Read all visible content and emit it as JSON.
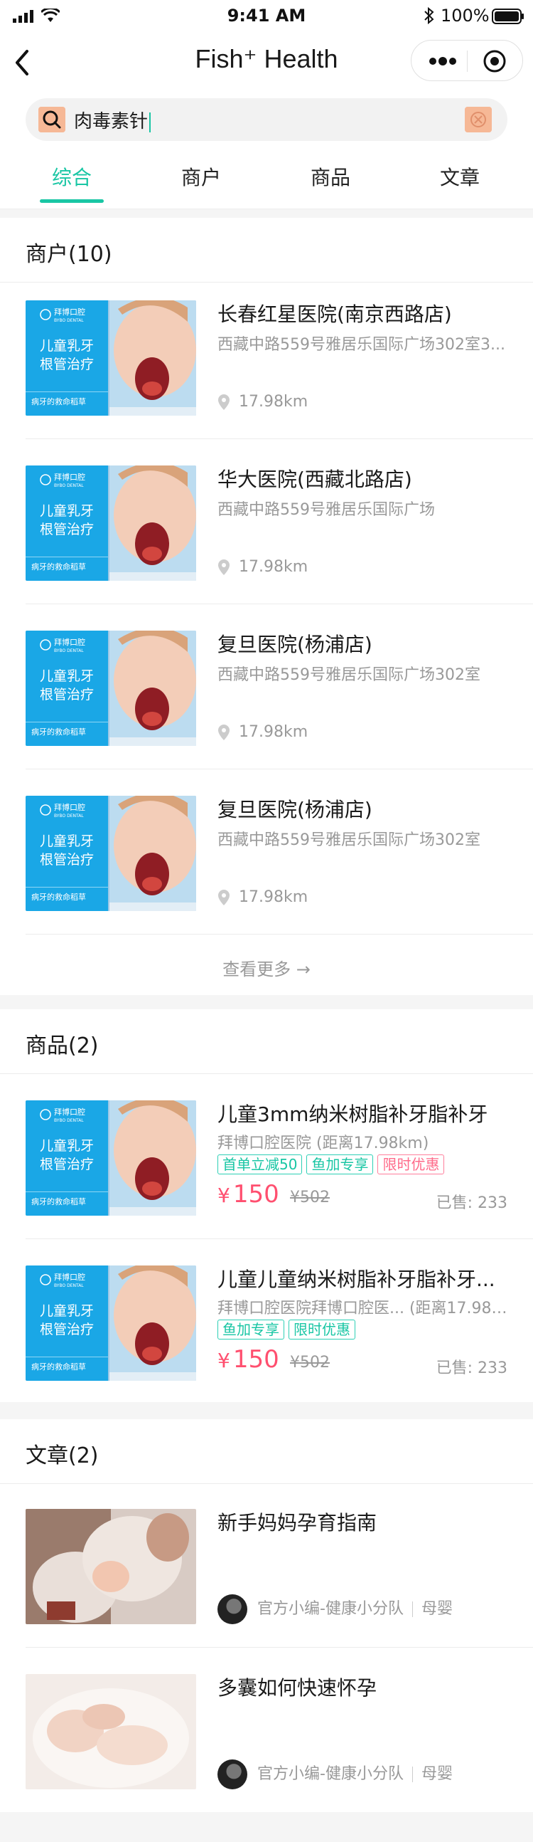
{
  "status_bar": {
    "time": "9:41 AM",
    "battery": "100%"
  },
  "nav": {
    "title": "Fish⁺ Health"
  },
  "search": {
    "query": "肉毒素针"
  },
  "tabs": [
    {
      "label": "综合"
    },
    {
      "label": "商户"
    },
    {
      "label": "商品"
    },
    {
      "label": "文章"
    }
  ],
  "merchants": {
    "title": "商户(10)",
    "more": "查看更多 →",
    "items": [
      {
        "name": "长春红星医院(南京西路店)",
        "address": "西藏中路559号雅居乐国际广场302室3...",
        "distance": "17.98km",
        "thumb_title": "儿童乳牙根管治疗",
        "thumb_brand": "拜博口腔",
        "thumb_foot": "病牙的救命稻草"
      },
      {
        "name": "华大医院(西藏北路店)",
        "address": "西藏中路559号雅居乐国际广场",
        "distance": "17.98km",
        "thumb_title": "儿童乳牙根管治疗",
        "thumb_brand": "拜博口腔",
        "thumb_foot": "病牙的救命稻草"
      },
      {
        "name": "复旦医院(杨浦店)",
        "address": "西藏中路559号雅居乐国际广场302室",
        "distance": "17.98km",
        "thumb_title": "儿童乳牙根管治疗",
        "thumb_brand": "拜博口腔",
        "thumb_foot": "病牙的救命稻草"
      },
      {
        "name": "复旦医院(杨浦店)",
        "address": "西藏中路559号雅居乐国际广场302室",
        "distance": "17.98km",
        "thumb_title": "儿童乳牙根管治疗",
        "thumb_brand": "拜博口腔",
        "thumb_foot": "病牙的救命稻草"
      }
    ]
  },
  "products": {
    "title": "商品(2)",
    "items": [
      {
        "name": "儿童3mm纳米树脂补牙脂补牙",
        "shop": "拜博口腔医院 (距离17.98km)",
        "tags": [
          "首单立减50",
          "鱼加专享",
          "限时优惠"
        ],
        "price_symbol": "¥",
        "price": "150",
        "old_price": "¥502",
        "sold": "已售: 233",
        "thumb_title": "儿童乳牙根管治疗",
        "thumb_brand": "拜博口腔",
        "thumb_foot": "病牙的救命稻草"
      },
      {
        "name": "儿童儿童纳米树脂补牙脂补牙...",
        "shop": "拜博口腔医院拜博口腔医... (距离17.98km)",
        "tags": [
          "鱼加专享",
          "限时优惠"
        ],
        "price_symbol": "¥",
        "price": "150",
        "old_price": "¥502",
        "sold": "已售: 233",
        "thumb_title": "儿童乳牙根管治疗",
        "thumb_brand": "拜博口腔",
        "thumb_foot": "病牙的救命稻草"
      }
    ]
  },
  "articles": {
    "title": "文章(2)",
    "items": [
      {
        "title": "新手妈妈孕育指南",
        "author": "官方小编-健康小分队",
        "category": "母婴"
      },
      {
        "title": "多囊如何快速怀孕",
        "author": "官方小编-健康小分队",
        "category": "母婴"
      }
    ]
  },
  "colors": {
    "accent": "#19c6a4",
    "price": "#ff4f6f",
    "thumb_blue": "#1aa7e6"
  }
}
